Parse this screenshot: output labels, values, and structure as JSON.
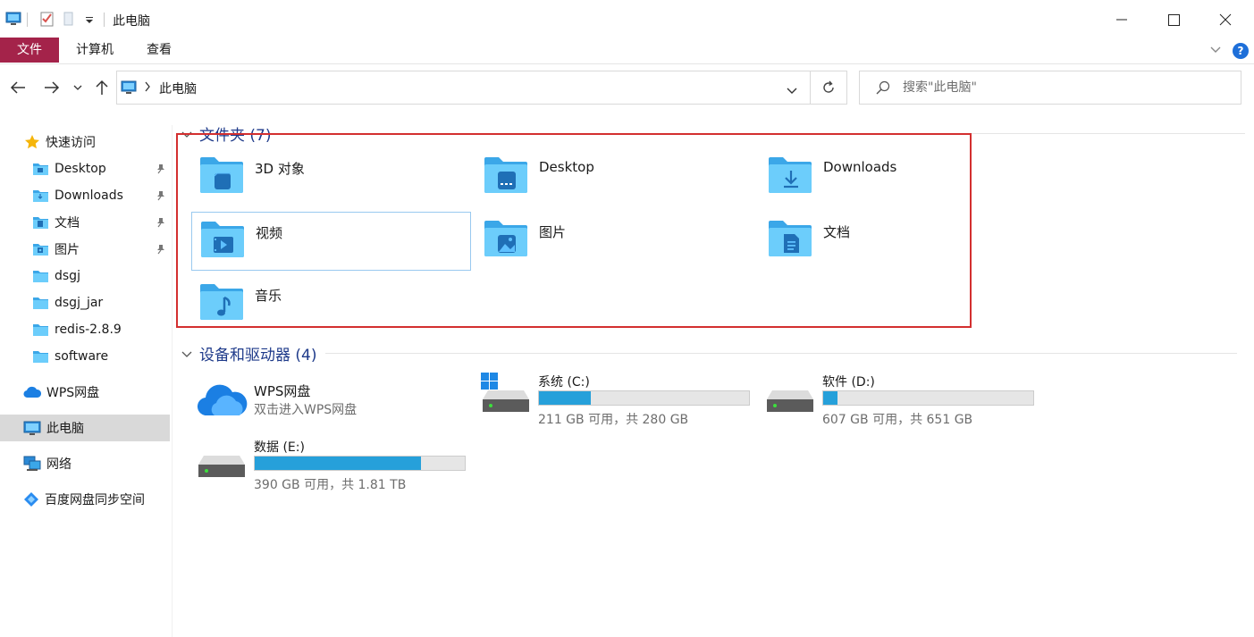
{
  "window": {
    "title": "此电脑",
    "minimize_icon": "minimize-icon",
    "maximize_icon": "maximize-icon",
    "close_icon": "close-icon"
  },
  "ribbon": {
    "tabs": [
      "文件",
      "计算机",
      "查看"
    ],
    "help_label": "?"
  },
  "address": {
    "path_item": "此电脑"
  },
  "search": {
    "placeholder": "搜索\"此电脑\""
  },
  "sidebar": {
    "quick_access": "快速访问",
    "items": [
      {
        "label": "Desktop",
        "icon": "desktop-folder-icon",
        "pinned": true
      },
      {
        "label": "Downloads",
        "icon": "downloads-folder-icon",
        "pinned": true
      },
      {
        "label": "文档",
        "icon": "documents-folder-icon",
        "pinned": true
      },
      {
        "label": "图片",
        "icon": "pictures-folder-icon",
        "pinned": true
      },
      {
        "label": "dsgj",
        "icon": "folder-icon",
        "pinned": false
      },
      {
        "label": "dsgj_jar",
        "icon": "folder-icon",
        "pinned": false
      },
      {
        "label": "redis-2.8.9",
        "icon": "folder-icon",
        "pinned": false
      },
      {
        "label": "software",
        "icon": "folder-icon",
        "pinned": false
      }
    ],
    "wps": "WPS网盘",
    "this_pc": "此电脑",
    "network": "网络",
    "baidu": "百度网盘同步空间"
  },
  "folders_group": {
    "title": "文件夹 (7)",
    "items": [
      {
        "label": "3D 对象",
        "icon": "3d-objects-folder-icon"
      },
      {
        "label": "Desktop",
        "icon": "desktop-folder-icon"
      },
      {
        "label": "Downloads",
        "icon": "downloads-folder-icon"
      },
      {
        "label": "视频",
        "icon": "videos-folder-icon"
      },
      {
        "label": "图片",
        "icon": "pictures-folder-icon"
      },
      {
        "label": "文档",
        "icon": "documents-folder-icon"
      },
      {
        "label": "音乐",
        "icon": "music-folder-icon"
      }
    ]
  },
  "drives_group": {
    "title": "设备和驱动器 (4)",
    "wps": {
      "name": "WPS网盘",
      "sub": "双击进入WPS网盘"
    },
    "drives": [
      {
        "name": "系统 (C:)",
        "sub": "211 GB 可用，共 280 GB",
        "used_fraction": 0.246,
        "system": true
      },
      {
        "name": "软件 (D:)",
        "sub": "607 GB 可用，共 651 GB",
        "used_fraction": 0.068,
        "system": false
      },
      {
        "name": "数据 (E:)",
        "sub": "390 GB 可用，共 1.81 TB",
        "used_fraction": 0.79,
        "system": false
      }
    ]
  },
  "colors": {
    "file_tab": "#a4234a",
    "accent": "#1e6fd9",
    "group_title": "#1e3a8a",
    "drive_fill": "#26a0da",
    "highlight_frame": "#d32f2f",
    "folder_blue": "#3ba7e8"
  }
}
